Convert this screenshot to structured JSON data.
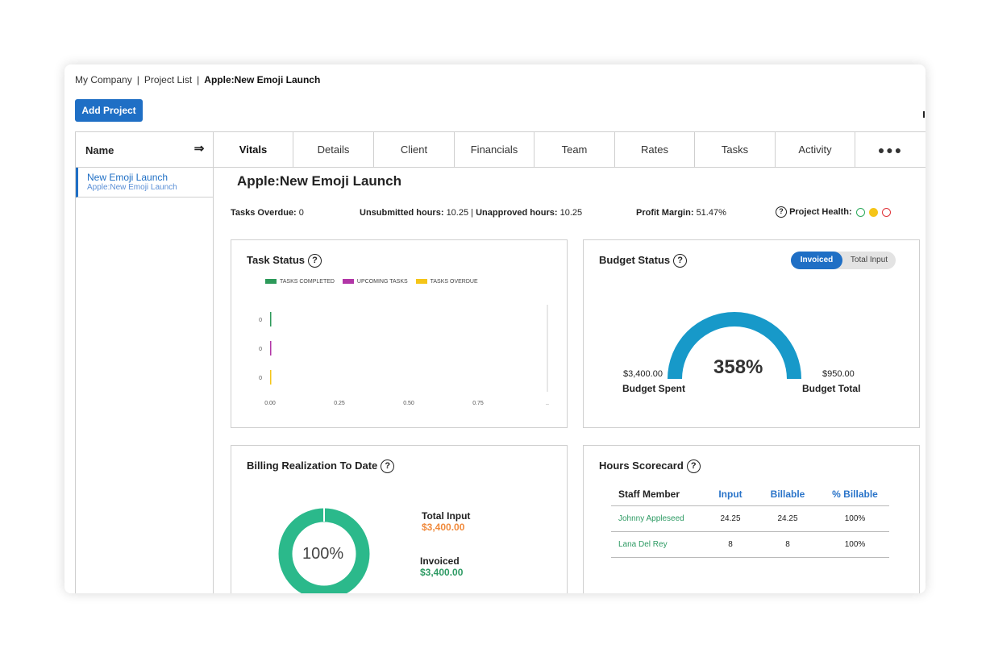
{
  "breadcrumb": {
    "company": "My Company",
    "project_list": "Project List",
    "current": "Apple:New Emoji Launch",
    "separator": "|"
  },
  "add_project_label": "Add Project",
  "left_panel": {
    "header": "Name",
    "collapse_icon": "collapse-panel-icon",
    "projects": [
      {
        "name": "New Emoji Launch",
        "subtitle": "Apple:New Emoji Launch"
      }
    ]
  },
  "tabs": [
    "Vitals",
    "Details",
    "Client",
    "Financials",
    "Team",
    "Rates",
    "Tasks",
    "Activity"
  ],
  "active_tab": "Vitals",
  "more_tabs": "●●●",
  "project_title": "Apple:New Emoji Launch",
  "metrics": {
    "tasks_overdue_label": "Tasks Overdue:",
    "tasks_overdue_value": "0",
    "unsubmitted_label": "Unsubmitted hours:",
    "unsubmitted_value": "10.25",
    "unapproved_label": "Unapproved hours:",
    "unapproved_value": "10.25",
    "profit_margin_label": "Profit Margin:",
    "profit_margin_value": "51.47%",
    "project_health_label": "Project Health:",
    "health_colors": {
      "green": "#2eaa5d",
      "yellow": "#f5c518",
      "red": "#e0343a"
    },
    "help_icon": "?"
  },
  "task_status": {
    "title": "Task Status",
    "legend": [
      "TASKS COMPLETED",
      "UPCOMING TASKS",
      "TASKS OVERDUE"
    ],
    "colors": [
      "#2d9a5a",
      "#b236a7",
      "#f5c518"
    ]
  },
  "chart_data": {
    "type": "bar",
    "orientation": "horizontal",
    "categories": [
      "",
      "",
      ""
    ],
    "series": [
      {
        "name": "TASKS COMPLETED",
        "values": [
          0,
          0,
          0
        ]
      },
      {
        "name": "UPCOMING TASKS",
        "values": [
          0,
          0,
          0
        ]
      },
      {
        "name": "TASKS OVERDUE",
        "values": [
          0,
          0,
          0
        ]
      }
    ],
    "y_tick_labels": [
      "0",
      "0",
      "0"
    ],
    "x_tick_labels": [
      "0.00",
      "0.25",
      "0.50",
      "0.75",
      ".."
    ],
    "xlim": [
      0,
      1
    ],
    "legend_position": "top"
  },
  "budget_status": {
    "title": "Budget Status",
    "toggle": {
      "active": "Invoiced",
      "inactive": "Total Input"
    },
    "percent_label": "358%",
    "percent_value": 358,
    "budget_spent_amount": "$3,400.00",
    "budget_spent_label": "Budget Spent",
    "budget_total_amount": "$950.00",
    "budget_total_label": "Budget Total",
    "gauge_color": "#1799c9"
  },
  "billing_realization": {
    "title": "Billing Realization To Date",
    "percent_label": "100%",
    "percent_value": 100,
    "donut_color": "#2bb98b",
    "total_input_label": "Total Input",
    "total_input_amount": "$3,400.00",
    "invoiced_label": "Invoiced",
    "invoiced_amount": "$3,400.00"
  },
  "hours_scorecard": {
    "title": "Hours Scorecard",
    "columns": [
      "Staff Member",
      "Input",
      "Billable",
      "% Billable"
    ],
    "rows": [
      {
        "name": "Johnny Appleseed",
        "input": "24.25",
        "billable": "24.25",
        "pct": "100%"
      },
      {
        "name": "Lana Del Rey",
        "input": "8",
        "billable": "8",
        "pct": "100%"
      }
    ]
  }
}
